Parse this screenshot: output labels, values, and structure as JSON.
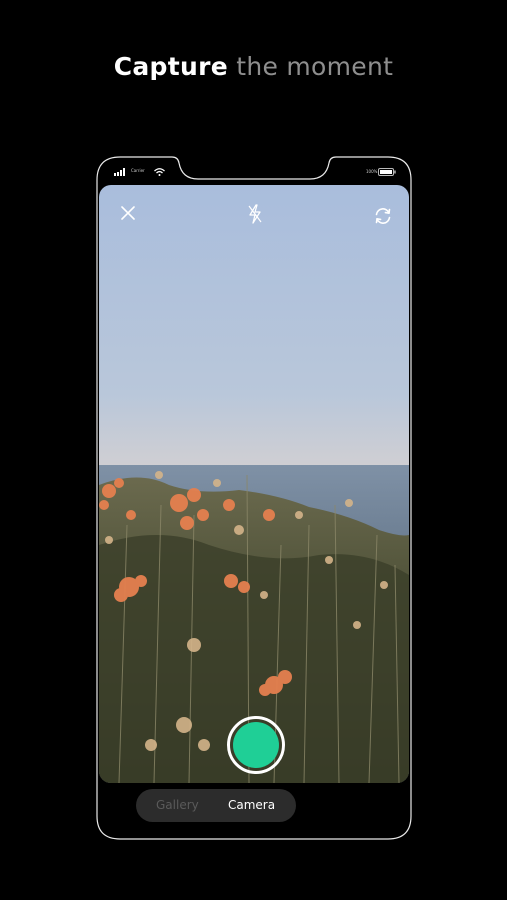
{
  "headline": {
    "strong": "Capture",
    "muted": " the moment"
  },
  "status_bar": {
    "carrier": "Carrier",
    "right_text": "100%"
  },
  "camera": {
    "close_icon": "close-icon",
    "flash_icon": "flash-off-icon",
    "flip_icon": "switch-camera-icon",
    "shutter_color": "#1fcf96"
  },
  "mode_switch": {
    "gallery": "Gallery",
    "camera": "Camera",
    "selected": "Camera"
  }
}
